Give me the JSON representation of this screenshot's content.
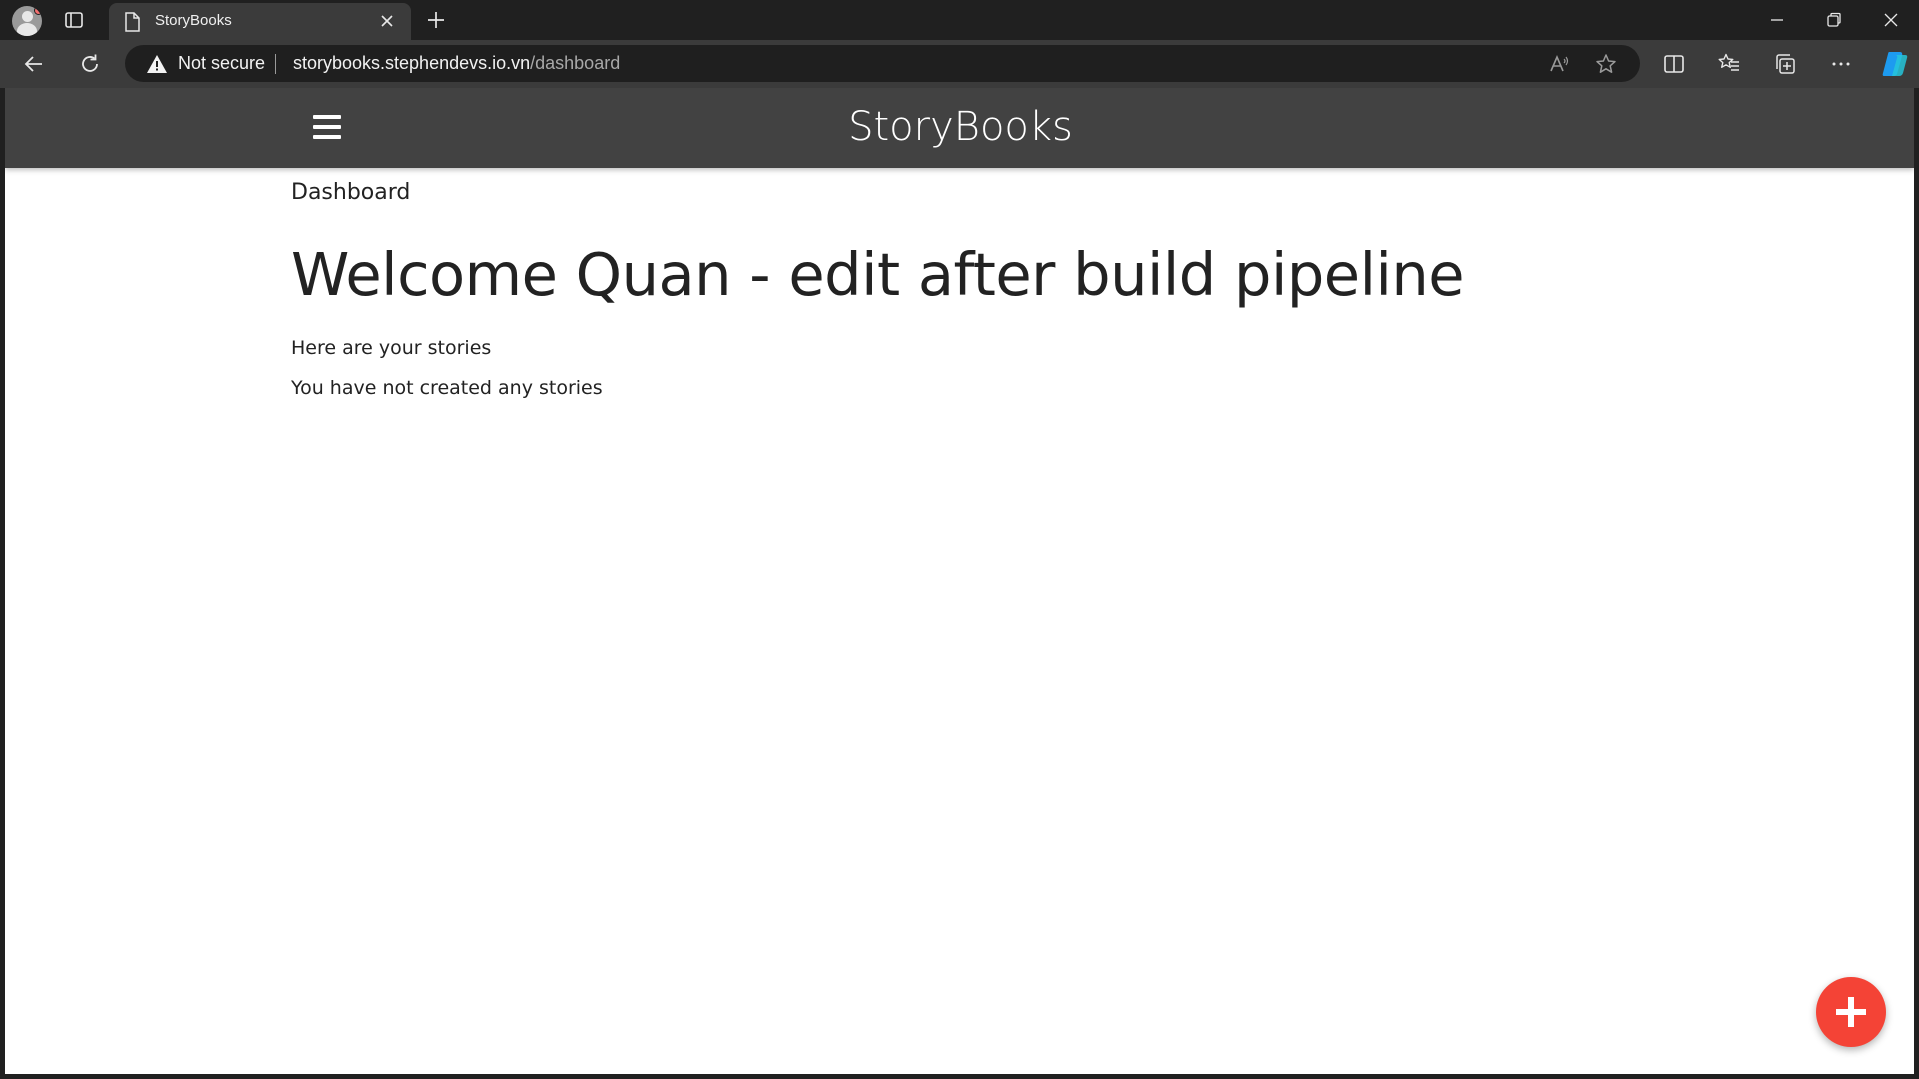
{
  "browser": {
    "tab": {
      "title": "StoryBooks"
    },
    "address": {
      "security_label": "Not secure",
      "url_host": "storybooks.stephendevs.io.vn",
      "url_path": "/dashboard"
    },
    "icons": {
      "profile": "profile-avatar-icon",
      "tabs": "tab-actions-icon",
      "new_tab": "plus-icon",
      "back": "back-arrow-icon",
      "refresh": "refresh-icon",
      "read_aloud": "read-aloud-icon",
      "favorite": "star-icon",
      "split_screen": "split-screen-icon",
      "favorites": "favorites-list-icon",
      "collections": "collections-icon",
      "more": "more-icon",
      "copilot": "copilot-icon"
    }
  },
  "app": {
    "brand": "StoryBooks",
    "section": "Dashboard",
    "welcome": "Welcome Quan - edit after build pipeline",
    "stories_intro": "Here are your stories",
    "empty_message": "You have not created any stories"
  },
  "colors": {
    "navbar": "#424242",
    "fab": "#f44336",
    "chrome": "#202020"
  }
}
